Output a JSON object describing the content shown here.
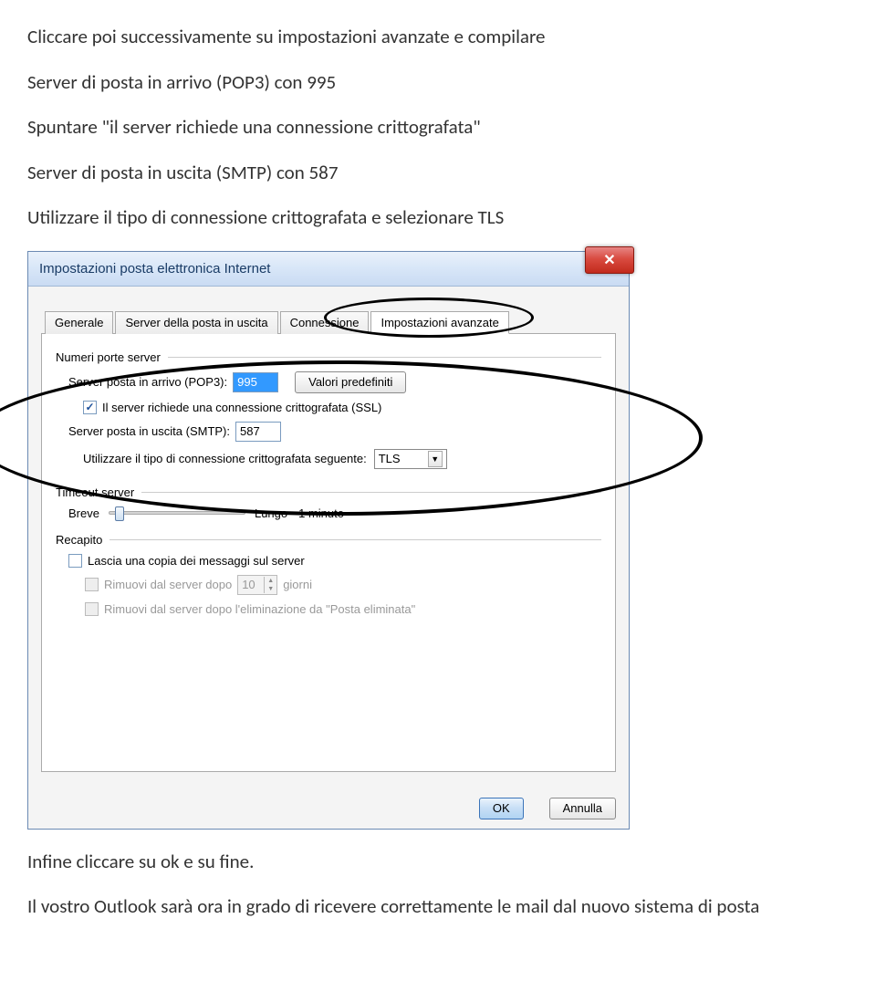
{
  "doc": {
    "p1": "Cliccare poi successivamente su impostazioni avanzate e compilare",
    "p2": "Server di posta in arrivo (POP3) con 995",
    "p3": "Spuntare \"il server richiede una connessione crittografata\"",
    "p4": "Server di posta in uscita (SMTP) con 587",
    "p5": "Utilizzare il tipo di connessione crittografata e selezionare TLS",
    "p6": "Infine cliccare su ok e su fine.",
    "p7": "Il vostro Outlook sarà ora in grado di ricevere correttamente le mail dal nuovo sistema di posta"
  },
  "dialog": {
    "title": "Impostazioni posta elettronica Internet",
    "tabs": {
      "general": "Generale",
      "outgoing": "Server della posta in uscita",
      "connection": "Connessione",
      "advanced": "Impostazioni avanzate"
    },
    "sections": {
      "ports": "Numeri porte server",
      "timeout": "Timeout server",
      "delivery": "Recapito"
    },
    "labels": {
      "pop3": "Server posta in arrivo (POP3):",
      "pop3_value": "995",
      "defaults_btn": "Valori predefiniti",
      "ssl_check": "Il server richiede una connessione crittografata (SSL)",
      "smtp": "Server posta in uscita (SMTP):",
      "smtp_value": "587",
      "enc_type": "Utilizzare il tipo di connessione crittografata seguente:",
      "enc_value": "TLS",
      "short": "Breve",
      "long": "Lungo",
      "duration": "1 minuto",
      "leave_copy": "Lascia una copia dei messaggi sul server",
      "remove_after": "Rimuovi dal server dopo",
      "remove_days_value": "10",
      "days": "giorni",
      "remove_deleted": "Rimuovi dal server dopo l'eliminazione da \"Posta eliminata\""
    },
    "buttons": {
      "ok": "OK",
      "cancel": "Annulla"
    }
  }
}
